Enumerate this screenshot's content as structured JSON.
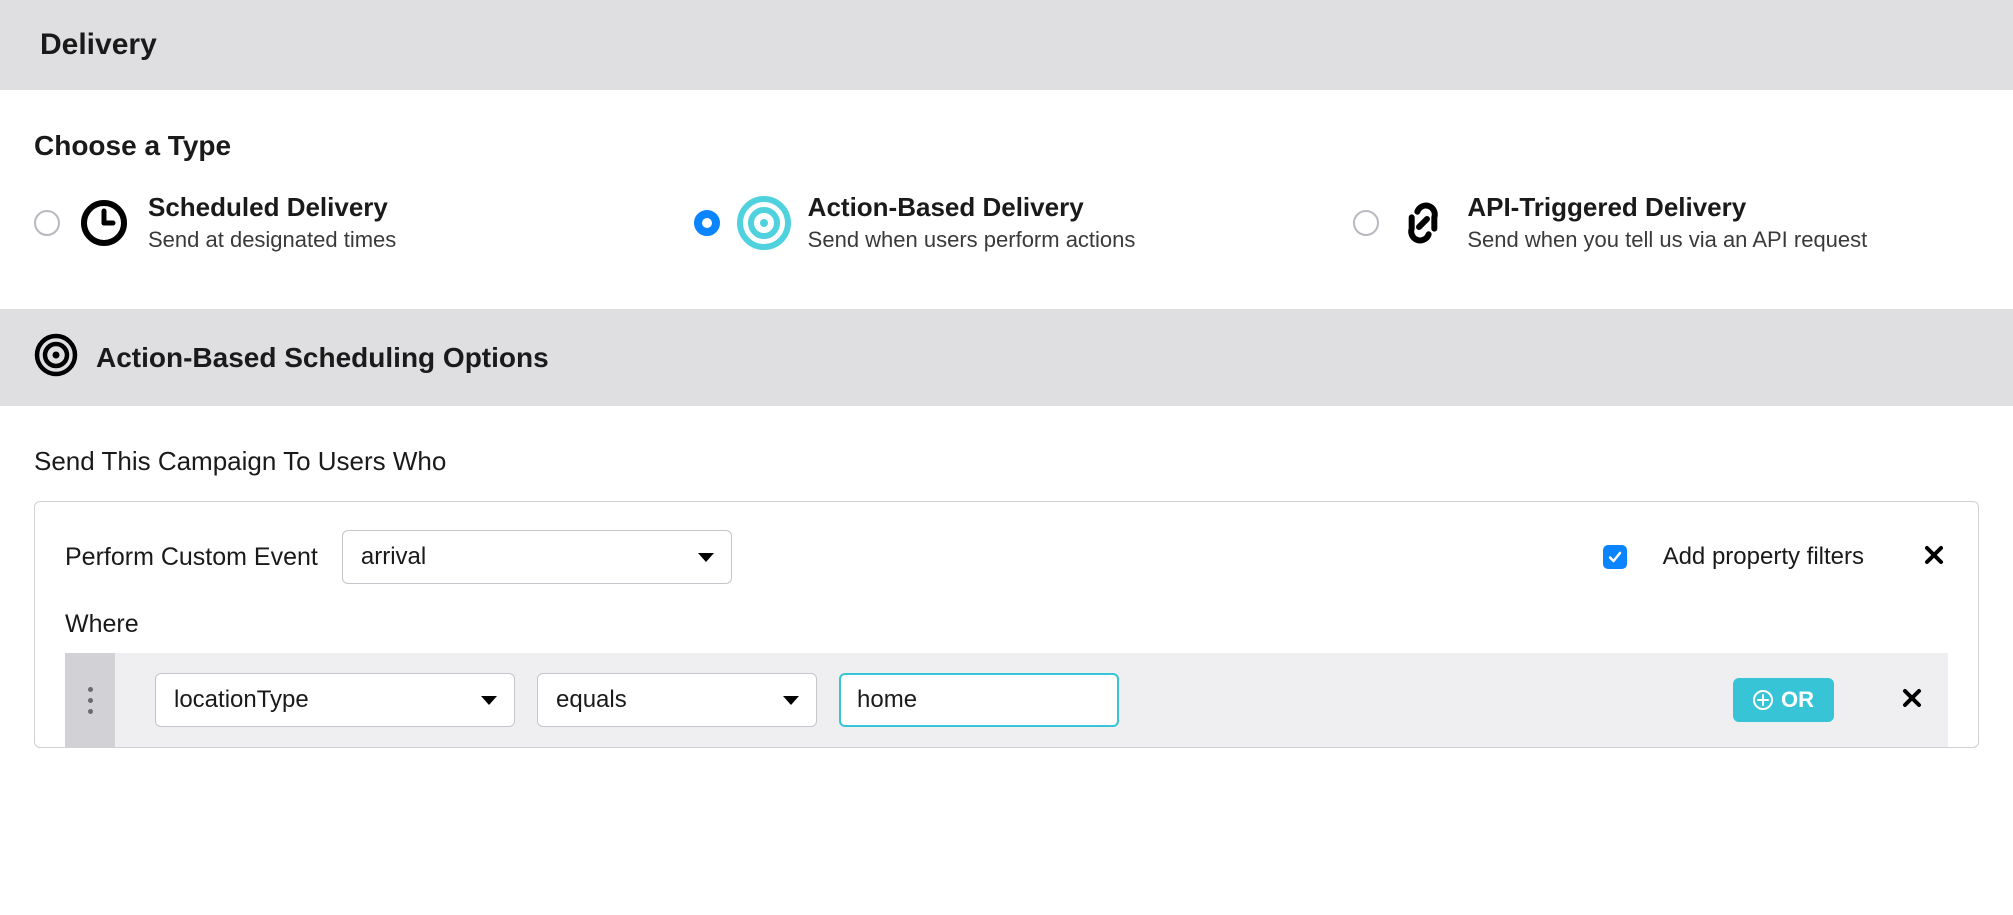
{
  "header": {
    "title": "Delivery"
  },
  "choose_type": {
    "heading": "Choose a Type",
    "options": [
      {
        "title": "Scheduled Delivery",
        "sub": "Send at designated times",
        "selected": false
      },
      {
        "title": "Action-Based Delivery",
        "sub": "Send when users perform actions",
        "selected": true
      },
      {
        "title": "API-Triggered Delivery",
        "sub": "Send when you tell us via an API request",
        "selected": false
      }
    ]
  },
  "scheduling_header": {
    "title": "Action-Based Scheduling Options"
  },
  "campaign": {
    "heading": "Send This Campaign To Users Who",
    "perform_label": "Perform Custom Event",
    "event_value": "arrival",
    "add_filters_label": "Add property filters",
    "add_filters_checked": true,
    "where_label": "Where",
    "filter": {
      "property": "locationType",
      "operator": "equals",
      "value": "home"
    },
    "or_label": "OR"
  },
  "colors": {
    "accent_blue": "#0a84ff",
    "accent_teal": "#37c4d6"
  }
}
